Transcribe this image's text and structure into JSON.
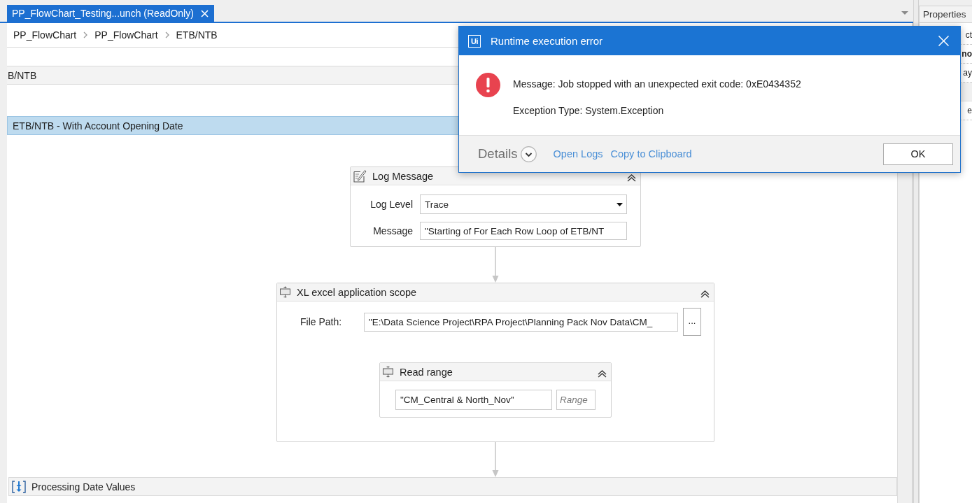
{
  "document_tab": {
    "title": "PP_FlowChart_Testing...unch (ReadOnly)",
    "selected": true
  },
  "breadcrumb": [
    {
      "label": "PP_FlowChart"
    },
    {
      "label": "PP_FlowChart"
    },
    {
      "label": "ETB/NTB"
    }
  ],
  "parent_header": {
    "title": "B/NTB"
  },
  "selected_header": {
    "title": "ETB/NTB - With Account Opening Date",
    "selected": true
  },
  "flowchart": {
    "nodes": [
      {
        "kind": "log_message",
        "title": "Log Message",
        "fields": [
          {
            "kind": "dropdown",
            "label": "Log Level",
            "value": "Trace"
          },
          {
            "kind": "text",
            "label": "Message",
            "value": "\"Starting of For Each Row Loop of ETB/NT"
          }
        ]
      },
      {
        "kind": "excel_scope",
        "title": "XL excel application scope",
        "file_path": {
          "label": "File Path:",
          "value": "\"E:\\Data Science Project\\RPA Project\\Planning Pack Nov Data\\CM_"
        },
        "browse_button": "...",
        "children": [
          {
            "kind": "read_range",
            "title": "Read range",
            "sheet": "\"CM_Central & North_Nov\"",
            "range": {
              "placeholder": "Range"
            }
          }
        ]
      },
      {
        "kind": "sequence",
        "title": "Processing Date Values"
      }
    ]
  },
  "properties_panel": {
    "title": "Properties",
    "rows": [
      {
        "kind": "text",
        "text": "ct"
      },
      {
        "kind": "category",
        "text": "no"
      },
      {
        "kind": "text",
        "text": "ay"
      },
      {
        "kind": "band"
      },
      {
        "kind": "text",
        "text": "e"
      }
    ]
  },
  "dialog": {
    "logo": "Ui",
    "title": "Runtime execution error",
    "message": "Message: Job stopped with an unexpected exit code: 0xE0434352",
    "exception": "Exception Type: System.Exception",
    "details": "Details",
    "links": [
      "Open Logs",
      "Copy to Clipboard"
    ],
    "ok_button": "OK"
  }
}
